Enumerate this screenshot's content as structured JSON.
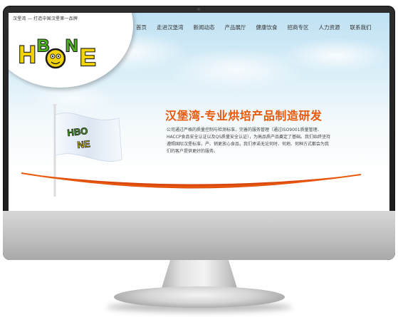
{
  "header": {
    "tagline": "汉堡湾 — 打造中国汉堡第一品牌",
    "logo_text": "HBONE"
  },
  "nav": {
    "items": [
      {
        "label": "首页"
      },
      {
        "label": "走进汉堡湾"
      },
      {
        "label": "新闻动态"
      },
      {
        "label": "产品展厅"
      },
      {
        "label": "健康饮食"
      },
      {
        "label": "招商专区"
      },
      {
        "label": "人力资源"
      },
      {
        "label": "联系我们"
      }
    ]
  },
  "hero": {
    "headline": "汉堡湾-专业烘培产品制造研发",
    "body": "公司通过严格的质量控制与检测标准，完善的服务管理（通过ISO9001质量管理、HACCP食品安全认证以及QS质量安全认证），为高品质产品奠定了基础。我们始终坚持遵照国际汉堡标准，产、销更放心食品，我们承诺无论何时、何地、何种方式都会为我们的客户提供更好的服务。"
  },
  "colors": {
    "accent": "#e8590c",
    "swoosh": "#d9480f",
    "bezel": "#1f1f1f",
    "logo_yellow": "#f2d20a",
    "logo_green": "#4caf1e"
  }
}
